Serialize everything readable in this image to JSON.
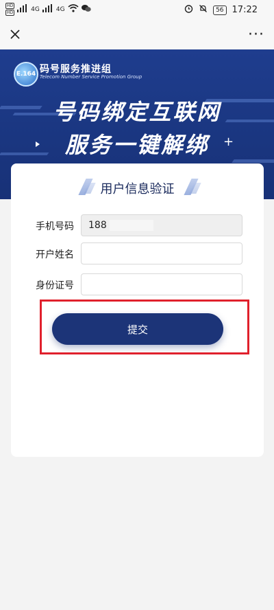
{
  "status_bar": {
    "hd_labels": [
      "HD",
      "HD"
    ],
    "net_labels": [
      "4G",
      "4G"
    ],
    "battery": "56",
    "time": "17:22"
  },
  "top_bar": {
    "more_glyph": "···"
  },
  "banner": {
    "logo_text": "E.164",
    "org_name": "码号服务推进组",
    "org_subtitle": "Telecom Number Service Promotion Group",
    "headline_line1": "号码绑定互联网",
    "headline_line2": "服务一键解绑",
    "plus_glyph": "+"
  },
  "form": {
    "title": "用户信息验证",
    "fields": [
      {
        "label": "手机号码",
        "value": "188",
        "filled": true
      },
      {
        "label": "开户姓名",
        "value": "",
        "filled": false
      },
      {
        "label": "身份证号",
        "value": "",
        "filled": false
      }
    ],
    "submit_label": "提交"
  },
  "colors": {
    "banner_bg": "#1f3d8e",
    "button_bg": "#1c3478",
    "highlight_border": "#e0202c"
  }
}
